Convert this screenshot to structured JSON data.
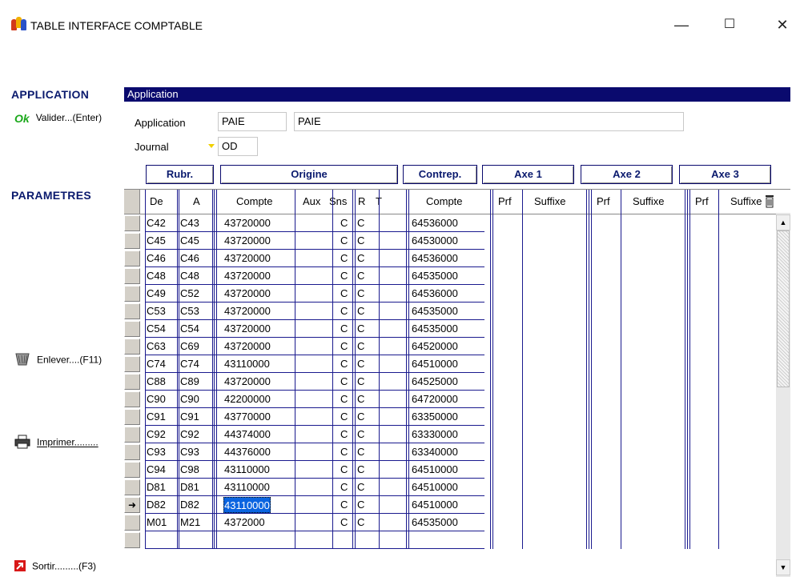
{
  "window": {
    "title": "TABLE INTERFACE COMPTABLE",
    "minimize": "—",
    "maximize": "☐",
    "close": "✕"
  },
  "sidebar": {
    "application_heading": "APPLICATION",
    "valider_icon": "Ok",
    "valider_label": "Valider...(Enter)",
    "parametres_heading": "PARAMETRES",
    "enlever_label": "Enlever....(F11)",
    "imprimer_label": "Imprimer.........",
    "sortir_label": "Sortir.........(F3)"
  },
  "application_bar": {
    "title": "Application"
  },
  "form": {
    "application_label": "Application",
    "application_code": "PAIE",
    "application_name": "PAIE",
    "journal_label": "Journal",
    "journal_value": "OD"
  },
  "groups": {
    "rubr": "Rubr.",
    "origine": "Origine",
    "contrep": "Contrep.",
    "axe1": "Axe 1",
    "axe2": "Axe 2",
    "axe3": "Axe 3"
  },
  "columns": {
    "de": "De",
    "a": "A",
    "compte": "Compte",
    "aux": "Aux",
    "sns": "Sns",
    "r": "R",
    "t": "T",
    "contrep_compte": "Compte",
    "prf1": "Prf",
    "suffixe1": "Suffixe",
    "prf2": "Prf",
    "suffixe2": "Suffixe",
    "prf3": "Prf",
    "suffixe3": "Suffixe"
  },
  "rows": [
    {
      "de": "C42",
      "a": "C43",
      "compte": "43720000",
      "sns": "C",
      "r": "C",
      "contrep": "64536000"
    },
    {
      "de": "C45",
      "a": "C45",
      "compte": "43720000",
      "sns": "C",
      "r": "C",
      "contrep": "64530000"
    },
    {
      "de": "C46",
      "a": "C46",
      "compte": "43720000",
      "sns": "C",
      "r": "C",
      "contrep": "64536000"
    },
    {
      "de": "C48",
      "a": "C48",
      "compte": "43720000",
      "sns": "C",
      "r": "C",
      "contrep": "64535000"
    },
    {
      "de": "C49",
      "a": "C52",
      "compte": "43720000",
      "sns": "C",
      "r": "C",
      "contrep": "64536000"
    },
    {
      "de": "C53",
      "a": "C53",
      "compte": "43720000",
      "sns": "C",
      "r": "C",
      "contrep": "64535000"
    },
    {
      "de": "C54",
      "a": "C54",
      "compte": "43720000",
      "sns": "C",
      "r": "C",
      "contrep": "64535000"
    },
    {
      "de": "C63",
      "a": "C69",
      "compte": "43720000",
      "sns": "C",
      "r": "C",
      "contrep": "64520000"
    },
    {
      "de": "C74",
      "a": "C74",
      "compte": "43110000",
      "sns": "C",
      "r": "C",
      "contrep": "64510000"
    },
    {
      "de": "C88",
      "a": "C89",
      "compte": "43720000",
      "sns": "C",
      "r": "C",
      "contrep": "64525000"
    },
    {
      "de": "C90",
      "a": "C90",
      "compte": "42200000",
      "sns": "C",
      "r": "C",
      "contrep": "64720000"
    },
    {
      "de": "C91",
      "a": "C91",
      "compte": "43770000",
      "sns": "C",
      "r": "C",
      "contrep": "63350000"
    },
    {
      "de": "C92",
      "a": "C92",
      "compte": "44374000",
      "sns": "C",
      "r": "C",
      "contrep": "63330000"
    },
    {
      "de": "C93",
      "a": "C93",
      "compte": "44376000",
      "sns": "C",
      "r": "C",
      "contrep": "63340000"
    },
    {
      "de": "C94",
      "a": "C98",
      "compte": "43110000",
      "sns": "C",
      "r": "C",
      "contrep": "64510000"
    },
    {
      "de": "D81",
      "a": "D81",
      "compte": "43110000",
      "sns": "C",
      "r": "C",
      "contrep": "64510000"
    },
    {
      "de": "D82",
      "a": "D82",
      "compte": "43110000",
      "sns": "C",
      "r": "C",
      "contrep": "64510000",
      "current": true
    },
    {
      "de": "M01",
      "a": "M21",
      "compte": "4372000",
      "sns": "C",
      "r": "C",
      "contrep": "64535000"
    },
    {
      "de": "",
      "a": "",
      "compte": "",
      "sns": "",
      "r": "",
      "contrep": ""
    }
  ],
  "colors": {
    "header_bar": "#0a0a6e",
    "heading_text": "#0a1a6e",
    "grid_line": "#1a1a8e",
    "selection": "#0a64e0",
    "ok_green": "#1aa81a"
  }
}
